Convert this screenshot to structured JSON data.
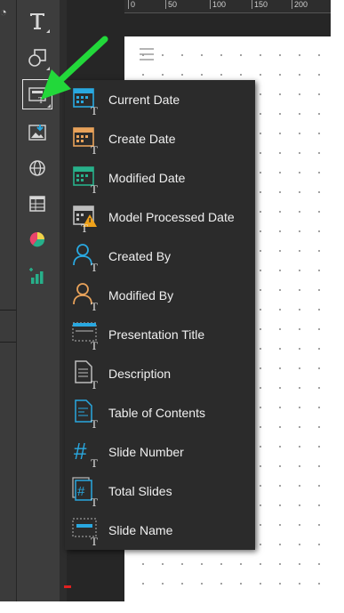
{
  "ruler": {
    "labels": [
      "0",
      "50",
      "100",
      "150",
      "200"
    ]
  },
  "toolbar": {
    "tools": [
      {
        "name": "text-tool",
        "icon": "text-icon"
      },
      {
        "name": "shape-tool",
        "icon": "shapes-icon"
      },
      {
        "name": "dynamic-text-tool",
        "icon": "dynamic-text-icon",
        "active": true
      },
      {
        "name": "image-tool",
        "icon": "image-icon"
      },
      {
        "name": "web-tool",
        "icon": "globe-icon"
      },
      {
        "name": "table-tool",
        "icon": "table-icon"
      },
      {
        "name": "visual-tool",
        "icon": "pie-chart-icon"
      },
      {
        "name": "chart-tool",
        "icon": "bar-chart-icon"
      }
    ]
  },
  "menu": {
    "items": [
      {
        "label": "Current Date",
        "icon": "calendar-current-icon"
      },
      {
        "label": "Create Date",
        "icon": "calendar-create-icon"
      },
      {
        "label": "Modified Date",
        "icon": "calendar-modified-icon"
      },
      {
        "label": "Model Processed Date",
        "icon": "calendar-warning-icon"
      },
      {
        "label": "Created By",
        "icon": "user-blue-icon"
      },
      {
        "label": "Modified By",
        "icon": "user-orange-icon"
      },
      {
        "label": "Presentation Title",
        "icon": "title-icon"
      },
      {
        "label": "Description",
        "icon": "document-icon"
      },
      {
        "label": "Table of Contents",
        "icon": "toc-icon"
      },
      {
        "label": "Slide Number",
        "icon": "hash-icon"
      },
      {
        "label": "Total Slides",
        "icon": "total-slides-icon"
      },
      {
        "label": "Slide Name",
        "icon": "slide-name-icon"
      }
    ]
  },
  "colors": {
    "accent_blue": "#29a8e0",
    "accent_orange": "#e8a25a",
    "accent_teal": "#27b08a",
    "arrow_green": "#22d83a"
  }
}
